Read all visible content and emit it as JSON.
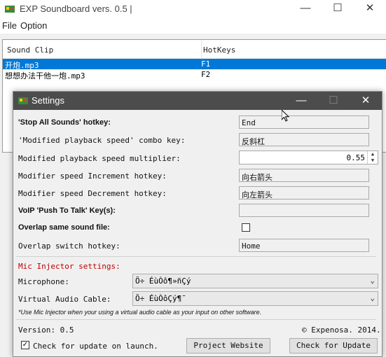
{
  "main_window": {
    "title": "EXP Soundboard vers. 0.5 |",
    "controls": {
      "minimize": "—",
      "maximize": "☐",
      "close": "✕"
    },
    "menu": [
      "File",
      "Option"
    ],
    "list": {
      "headers": [
        "Sound Clip",
        "HotKeys"
      ],
      "rows": [
        {
          "clip": "开炮.mp3",
          "hotkey": "F1",
          "selected": true
        },
        {
          "clip": "想想办法干他一炮.mp3",
          "hotkey": "F2",
          "selected": false
        }
      ]
    }
  },
  "settings_dialog": {
    "title": "Settings",
    "controls": {
      "minimize": "—",
      "maximize": "☐",
      "close": "✕"
    },
    "stop_all": {
      "label": "'Stop All Sounds' hotkey:",
      "value": "End"
    },
    "modified_combo": {
      "label": "'Modified playback speed' combo key:",
      "value": "反斜杠"
    },
    "speed_multiplier": {
      "label": "Modified playback speed multiplier:",
      "value": "0.55"
    },
    "speed_increment": {
      "label": "Modifier speed Increment hotkey:",
      "value": "向右箭头"
    },
    "speed_decrement": {
      "label": "Modifier speed Decrement hotkey:",
      "value": "向左箭头"
    },
    "voip_ptt": {
      "label": "VoIP 'Push To Talk' Key(s):",
      "value": ""
    },
    "overlap_same": {
      "label": "Overlap same sound file:",
      "checked": false
    },
    "overlap_switch": {
      "label": "Overlap switch hotkey:",
      "value": "Home"
    },
    "mic_injector": {
      "section_title": "Mic Injector settings:",
      "microphone_label": "Microphone:",
      "microphone_value": "Ö÷ ÉùÒô¶»ñÇý",
      "virtual_cable_label": "Virtual Audio Cable:",
      "virtual_cable_value": "Ö÷ ÉùÒôÇý¶¯",
      "note": "*Use Mic Injector when your using a virtual audio cable as your input on other software."
    },
    "version": "Version: 0.5",
    "copyright": "© Expenosa. 2014.",
    "check_update_launch": {
      "label": "Check for update on launch.",
      "checked": true
    },
    "buttons": {
      "project_website": "Project Website",
      "check_update": "Check for Update"
    }
  },
  "colors": {
    "selection": "#0078d7",
    "dialog_titlebar": "#4c4c4c",
    "section_red": "#c00000"
  }
}
